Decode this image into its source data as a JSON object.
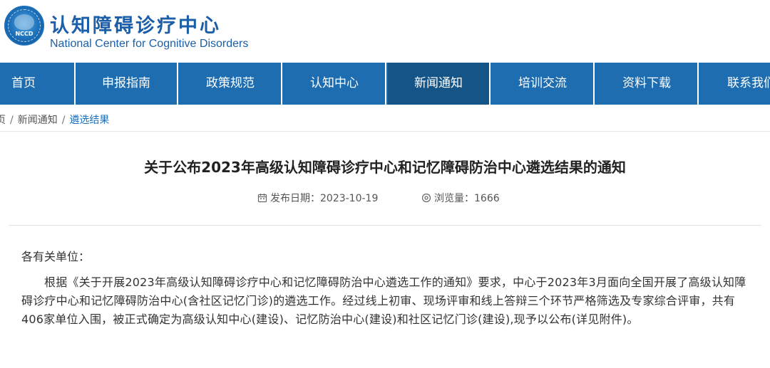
{
  "header": {
    "title_cn": "认知障碍诊疗中心",
    "title_en": "National Center for Cognitive Disorders",
    "logo_text": "NCCD"
  },
  "nav": {
    "items": [
      {
        "label": "首页"
      },
      {
        "label": "申报指南"
      },
      {
        "label": "政策规范"
      },
      {
        "label": "认知中心"
      },
      {
        "label": "新闻通知",
        "active": true
      },
      {
        "label": "培训交流"
      },
      {
        "label": "资料下载"
      },
      {
        "label": "联系我们"
      }
    ]
  },
  "breadcrumb": {
    "home": "页",
    "section": "新闻通知",
    "current": "遴选结果"
  },
  "article": {
    "title": "关于公布2023年高级认知障碍诊疗中心和记忆障碍防治中心遴选结果的通知",
    "date_label": "发布日期：2023-10-19",
    "views_label": "浏览量：1666",
    "greeting": "各有关单位：",
    "body": "根据《关于开展2023年高级认知障碍诊疗中心和记忆障碍防治中心遴选工作的通知》要求，中心于2023年3月面向全国开展了高级认知障碍诊疗中心和记忆障碍防治中心(含社区记忆门诊)的遴选工作。经过线上初审、现场评审和线上答辩三个环节严格筛选及专家综合评审，共有406家单位入围，被正式确定为高级认知中心(建设)、记忆防治中心(建设)和社区记忆门诊(建设),现予以公布(详见附件)。"
  },
  "colors": {
    "nav_bg": "#1e6db0",
    "nav_active": "#145487",
    "brand": "#1c5fa8",
    "breadcrumb_current": "#1c6fb8"
  }
}
